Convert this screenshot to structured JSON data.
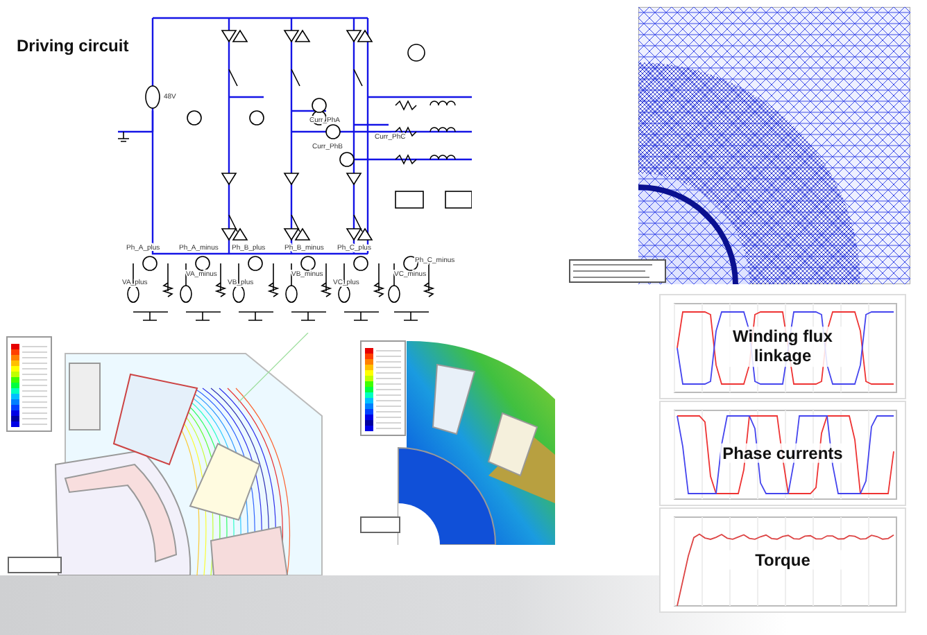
{
  "circuit": {
    "caption": "Driving circuit",
    "source_label": "48V",
    "current_labels": [
      "Curr_PhA",
      "Curr_PhB",
      "Curr_PhC"
    ],
    "sensor_labels": [
      "Ph_A_plus",
      "Ph_A_minus",
      "Ph_B_plus",
      "Ph_B_minus",
      "Ph_C_plus",
      "Ph_C_minus"
    ],
    "source_labels": [
      "VA_plus",
      "VA_minus",
      "VB_plus",
      "VB_minus",
      "VC_plus",
      "VC_minus"
    ]
  },
  "plots": [
    {
      "kind": "flux",
      "caption": "Winding flux linkage"
    },
    {
      "kind": "current",
      "caption": "Phase currents"
    },
    {
      "kind": "torque",
      "caption": "Torque"
    }
  ]
}
